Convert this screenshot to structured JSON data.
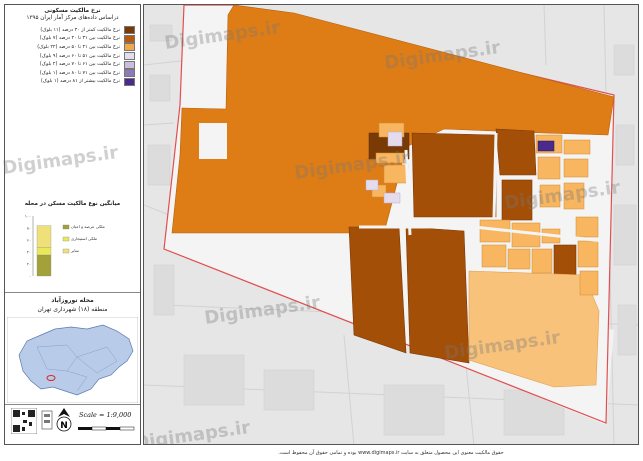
{
  "sidebar": {
    "title_line1": "نرخ مالکیت مسکونی",
    "title_line2": "دراساس داده‌های مرکز آمار ایران ۱۳۹۵",
    "legend": [
      {
        "label": "نرخ مالکیت کمتر از ۳۰ درصد (۱۱ بلوک)",
        "color": "#7a3a05"
      },
      {
        "label": "نرخ مالکیت بین ۳۱ تا ۴۰ درصد (۷ بلوک)",
        "color": "#b85a0c"
      },
      {
        "label": "نرخ مالکیت بین ۴۱ تا ۵۰ درصد (۲۲ بلوک)",
        "color": "#f3a64a"
      },
      {
        "label": "نرخ مالکیت بین ۵۱ تا ۶۰ درصد (۹ بلوک)",
        "color": "#e4dcec"
      },
      {
        "label": "نرخ مالکیت بین ۶۱ تا ۷۰ درصد (۲ بلوک)",
        "color": "#c9bfdc"
      },
      {
        "label": "نرخ مالکیت بین ۷۱ تا ۸۰ درصد (۱ بلوک)",
        "color": "#8d7ab9"
      },
      {
        "label": "نرخ مالکیت بیشتر از ۸۱ درصد (۱ بلوک)",
        "color": "#4a2a8a"
      }
    ],
    "chart_title": "میانگین نوع مالکیت مسکن در محله",
    "neighborhood": "محله نوروزآباد",
    "district": "منطقه (۱۸) شهرداری تهران",
    "scale": "Scale = 1:9,000",
    "north": "N"
  },
  "chart_data": {
    "type": "bar",
    "title": "میانگین نوع مالکیت مسکن در محله",
    "categories": [
      ""
    ],
    "series": [
      {
        "name": "ملکی عرصه و اعیان",
        "values": [
          35
        ],
        "color": "#a3a23a"
      },
      {
        "name": "ملکی استیجاری",
        "values": [
          13
        ],
        "color": "#e8e85a"
      },
      {
        "name": "سایر",
        "values": [
          36
        ],
        "color": "#f0e07a"
      }
    ],
    "ytick_labels": [
      "۱۰۰",
      "۸۰",
      "۶۰",
      "۴۰",
      "۲۰",
      "۰"
    ],
    "ylim": [
      0,
      100
    ]
  },
  "watermark": "Digimaps.ir",
  "footer": "حقوق مالکیت معنوی این محصول متعلق به سایت www.digimaps.ir بوده و تمامی حقوق آن محفوظ است.",
  "colors": {
    "bg_map": "#e9e9e9",
    "main_orange": "#de7c16",
    "boundary": "#e05050",
    "road": "#f7f7f7"
  }
}
